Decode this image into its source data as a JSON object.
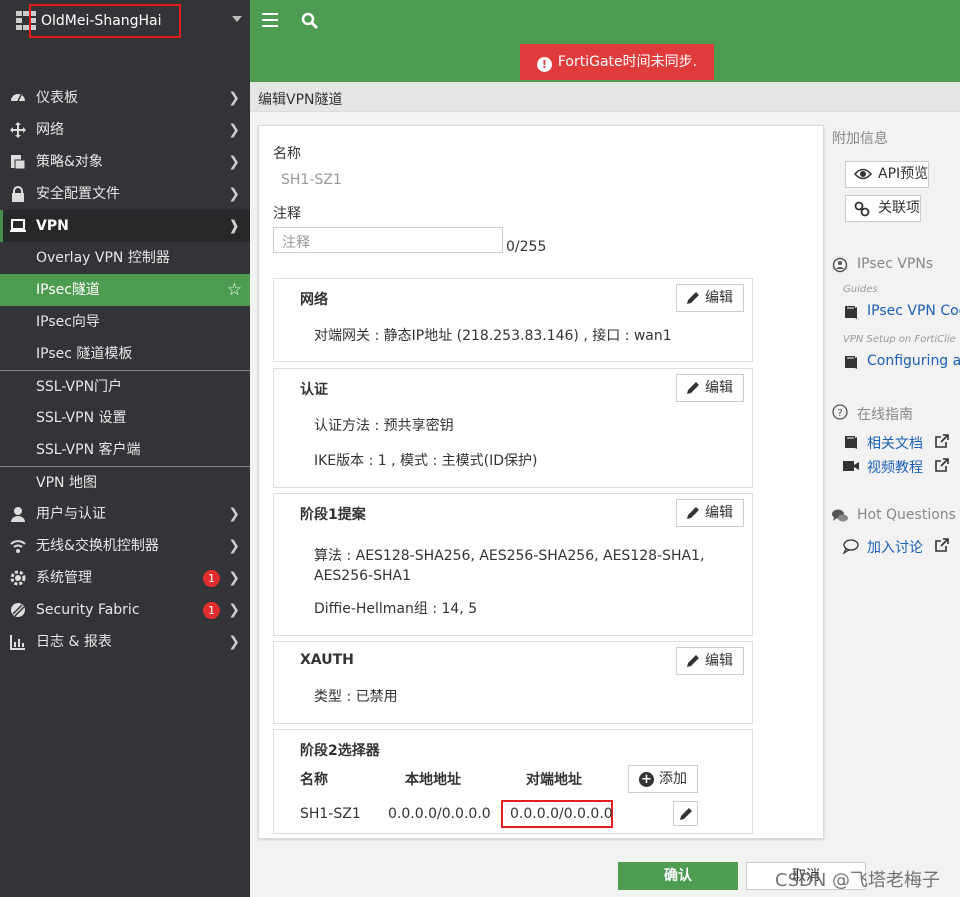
{
  "sidebar": {
    "device_name": "OldMei-ShangHai",
    "items": [
      {
        "label": "仪表板",
        "icon": "dashboard-icon"
      },
      {
        "label": "网络",
        "icon": "network-icon"
      },
      {
        "label": "策略&对象",
        "icon": "policy-icon"
      },
      {
        "label": "安全配置文件",
        "icon": "lock-icon"
      },
      {
        "label": "VPN",
        "icon": "laptop-icon"
      }
    ],
    "vpn_sub": [
      "Overlay VPN 控制器",
      "IPsec隧道",
      "IPsec向导",
      "IPsec 隧道模板",
      "SSL-VPN门户",
      "SSL-VPN 设置",
      "SSL-VPN 客户端",
      "VPN 地图"
    ],
    "items_after": [
      {
        "label": "用户与认证",
        "icon": "user-icon"
      },
      {
        "label": "无线&交换机控制器",
        "icon": "wifi-icon"
      },
      {
        "label": "系统管理",
        "icon": "gear-icon",
        "badge": "1"
      },
      {
        "label": "Security Fabric",
        "icon": "fabric-icon",
        "badge": "1"
      },
      {
        "label": "日志 & 报表",
        "icon": "chart-icon"
      }
    ]
  },
  "topbar": {
    "alert": "FortiGate时间未同步."
  },
  "page": {
    "title": "编辑VPN隧道"
  },
  "form": {
    "name_label": "名称",
    "name_value": "SH1-SZ1",
    "comment_label": "注释",
    "comment_placeholder": "注释",
    "comment_counter": "0/255",
    "edit_label": "编辑",
    "network": {
      "title": "网络",
      "line1": "对端网关 : 静态IP地址 (218.253.83.146) , 接口 : wan1"
    },
    "auth": {
      "title": "认证",
      "line1": "认证方法 : 预共享密钥",
      "line2": "IKE版本 : 1 , 模式 : 主模式(ID保护)"
    },
    "phase1": {
      "title": "阶段1提案",
      "line1": "算法 : AES128-SHA256, AES256-SHA256, AES128-SHA1, AES256-SHA1",
      "line2": "Diffie-Hellman组 : 14, 5"
    },
    "xauth": {
      "title": "XAUTH",
      "line1": "类型 : 已禁用"
    },
    "phase2": {
      "title": "阶段2选择器",
      "col_name": "名称",
      "col_local": "本地地址",
      "col_remote": "对端地址",
      "add_label": "添加",
      "row_name": "SH1-SZ1",
      "row_local": "0.0.0.0/0.0.0.0",
      "row_remote": "0.0.0.0/0.0.0.0"
    }
  },
  "info": {
    "title": "附加信息",
    "api_preview": "API预览",
    "references": "关联项",
    "ipsec_title": "IPsec VPNs",
    "guides_small": "Guides",
    "guide_link": "IPsec VPN Coo",
    "vpn_setup_small": "VPN Setup on FortiClie",
    "configuring_link": "Configuring an",
    "online_title": "在线指南",
    "docs_link": "相关文档",
    "video_link": "视频教程",
    "hot_title": "Hot Questions a",
    "discuss_link": "加入讨论"
  },
  "actions": {
    "ok": "确认",
    "cancel": "取消"
  },
  "watermark": "CSDN @飞塔老梅子",
  "colors": {
    "accent_green": "#4e9c52",
    "sidebar_bg": "#333437",
    "alert_red": "#e03b3b",
    "highlight_red": "#e21d1d",
    "link_blue": "#1b60b6"
  }
}
